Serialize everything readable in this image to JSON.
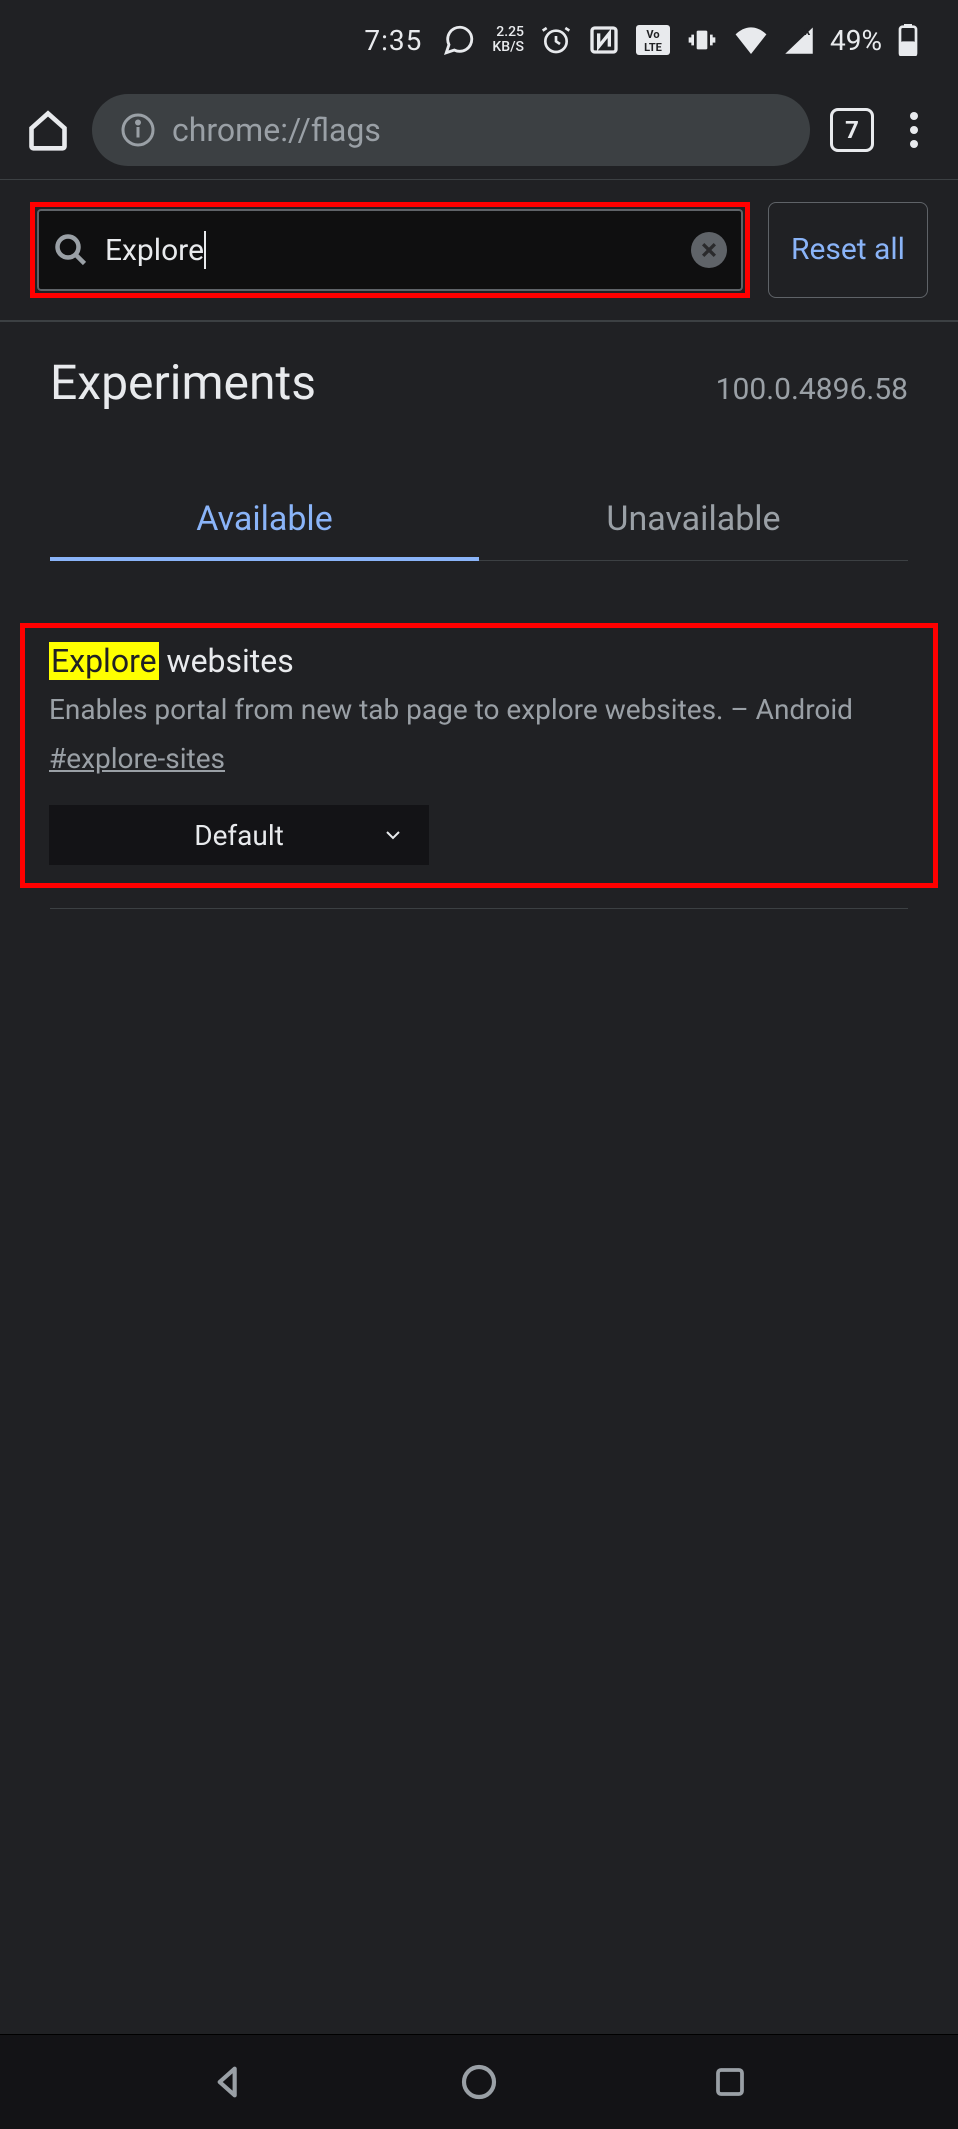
{
  "status": {
    "time": "7:35",
    "kbs_top": "2.25",
    "kbs_bottom": "KB/S",
    "battery_percent": "49%"
  },
  "browser": {
    "url": "chrome://flags",
    "tab_count": "7"
  },
  "search": {
    "value": "Explore",
    "reset_label": "Reset all"
  },
  "header": {
    "title": "Experiments",
    "version": "100.0.4896.58"
  },
  "tabs": {
    "available": "Available",
    "unavailable": "Unavailable"
  },
  "flag": {
    "title_highlight": "Explore",
    "title_rest": " websites",
    "description": "Enables portal from new tab page to explore websites. – Android",
    "hash": "#explore-sites",
    "select_value": "Default"
  }
}
